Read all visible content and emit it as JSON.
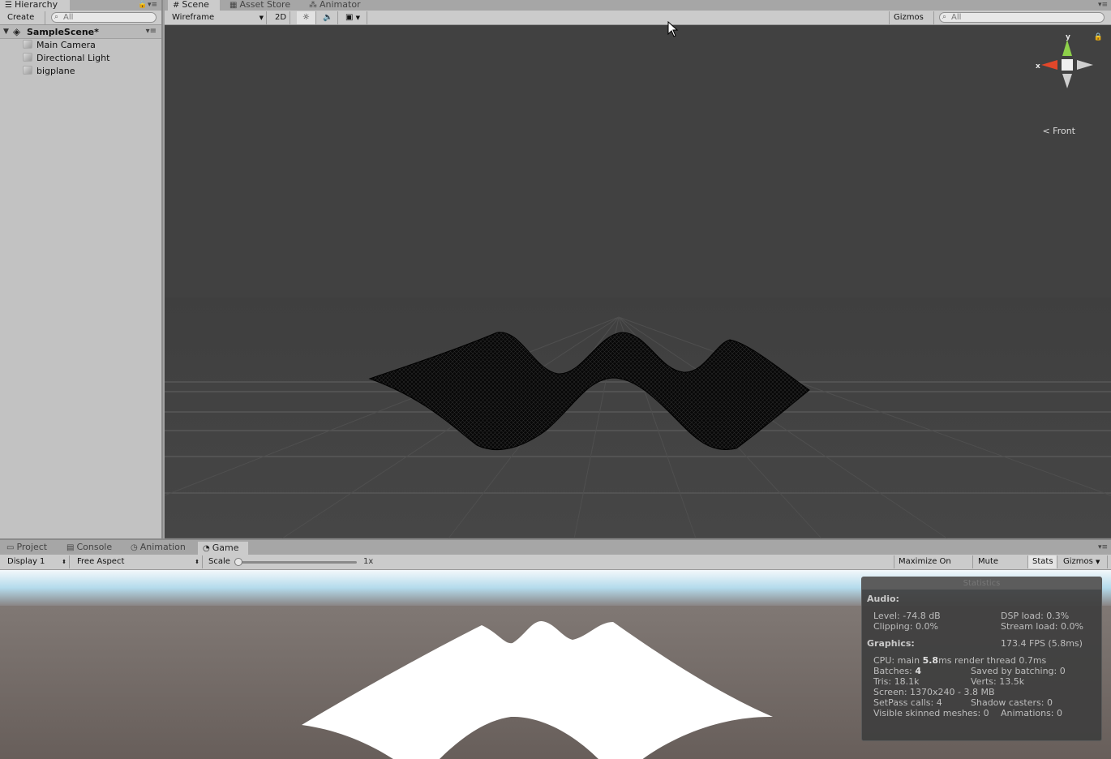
{
  "hierarchy": {
    "tab": "Hierarchy",
    "create": "Create",
    "search_placeholder": "All",
    "scene_name": "SampleScene*",
    "items": [
      "Main Camera",
      "Directional Light",
      "bigplane"
    ]
  },
  "scene_tabs": [
    "Scene",
    "Asset Store",
    "Animator"
  ],
  "scene_toolbar": {
    "shading_mode": "Wireframe",
    "mode_2d": "2D",
    "gizmos": "Gizmos",
    "search_placeholder": "All"
  },
  "scene_gizmo": {
    "x_label": "x",
    "y_label": "y",
    "view_label": "Front"
  },
  "bottom_tabs": [
    "Project",
    "Console",
    "Animation",
    "Game"
  ],
  "game_toolbar": {
    "display": "Display 1",
    "aspect": "Free Aspect",
    "scale_label": "Scale",
    "scale_value": "1x",
    "maximize": "Maximize On Play",
    "mute": "Mute Audio",
    "stats": "Stats",
    "gizmos": "Gizmos"
  },
  "stats": {
    "title": "Statistics",
    "audio_header": "Audio:",
    "level": "Level: -74.8 dB",
    "clipping": "Clipping: 0.0%",
    "dsp_load": "DSP load: 0.3%",
    "stream_load": "Stream load: 0.0%",
    "graphics_header": "Graphics:",
    "fps": "173.4 FPS (5.8ms)",
    "cpu_prefix": "CPU: main ",
    "cpu_main": "5.8",
    "cpu_suffix": "ms  render thread 0.7ms",
    "batches_prefix": "Batches: ",
    "batches": "4",
    "saved_batching": "Saved by batching: 0",
    "tris": "Tris: 18.1k",
    "verts": "Verts: 13.5k",
    "screen": "Screen: 1370x240 - 3.8 MB",
    "setpass": "SetPass calls: 4",
    "shadow_casters": "Shadow casters: 0",
    "skinned": "Visible skinned meshes: 0",
    "animations": "Animations: 0"
  }
}
